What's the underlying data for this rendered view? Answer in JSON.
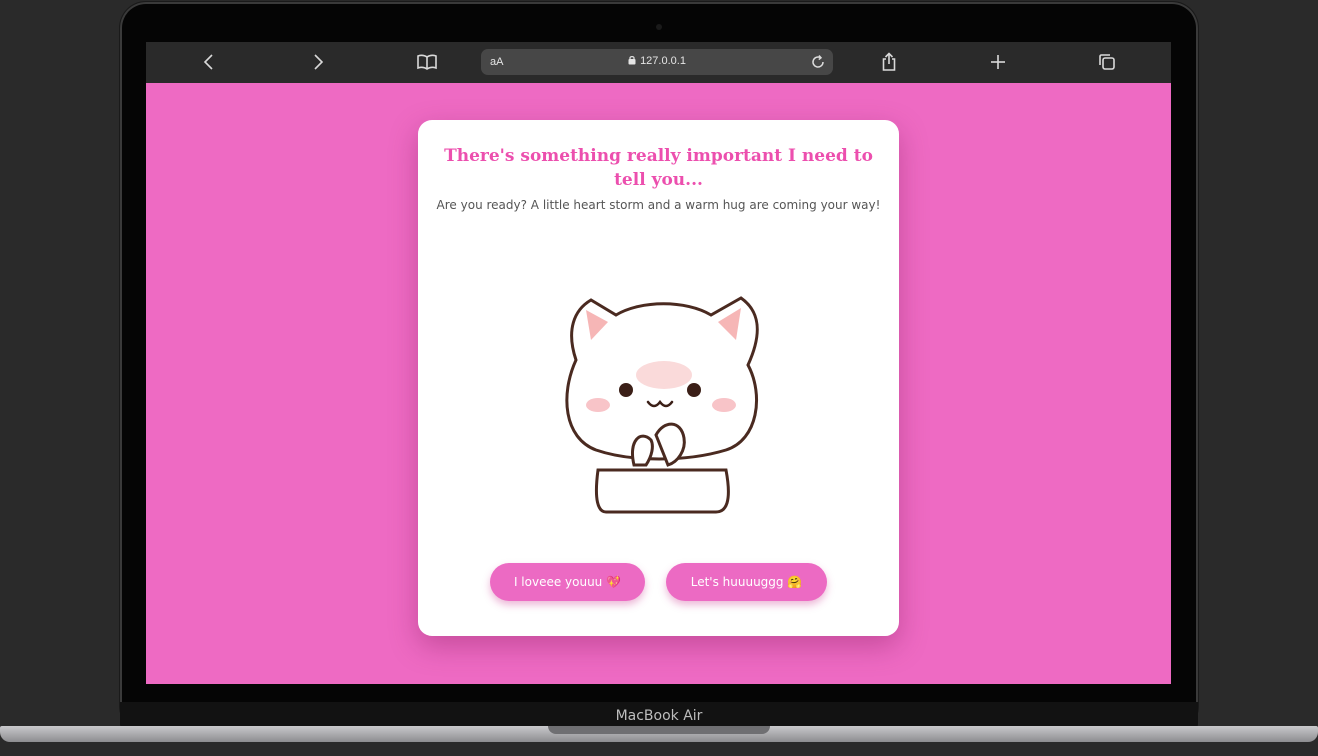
{
  "device": {
    "brand_label": "MacBook Air"
  },
  "browser": {
    "text_size_label": "aA",
    "url": "127.0.0.1",
    "icons": [
      "chevron-left-icon",
      "chevron-right-icon",
      "book-icon",
      "lock-icon",
      "reload-icon",
      "share-icon",
      "plus-icon",
      "tabs-icon"
    ]
  },
  "page": {
    "background_color": "#ee6ac3",
    "title": "There's something really important I need to tell you...",
    "subtitle": "Are you ready? A little heart storm and a warm hug are coming your way!",
    "buttons": {
      "love_label": "I loveee youuu 💖",
      "hug_label": "Let's huuuuggg 🤗"
    },
    "accent_color": "#ec4fae"
  }
}
